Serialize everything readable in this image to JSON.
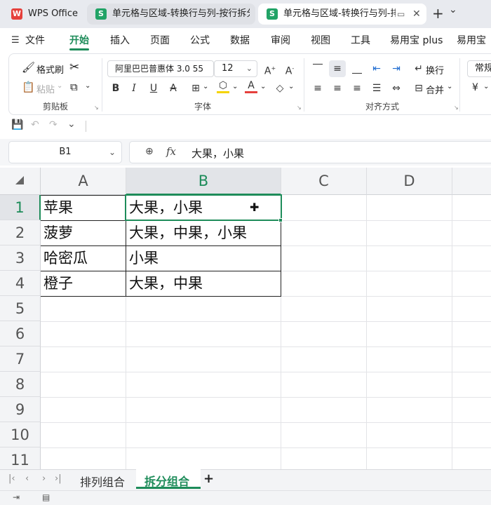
{
  "tabs": [
    {
      "logo": "W",
      "title": "WPS Office",
      "active": false
    },
    {
      "logo": "S",
      "title": "单元格与区域-转换行与列-按行拆分",
      "active": false
    },
    {
      "logo": "S",
      "title": "单元格与区域-转换行与列-排",
      "active": true
    }
  ],
  "tab_new_icon": "+",
  "tab_list_icon": "⌄",
  "menu": {
    "file": "文件",
    "items": [
      "开始",
      "插入",
      "页面",
      "公式",
      "数据",
      "审阅",
      "视图",
      "工具",
      "易用宝 plus",
      "易用宝"
    ],
    "active": "开始"
  },
  "ribbon": {
    "format_painter": "格式刷",
    "paste": "粘贴",
    "clipboard_group": "剪贴板",
    "font_name": "阿里巴巴普惠体 3.0 55",
    "font_size": "12",
    "font_group": "字体",
    "wrap": "换行",
    "merge": "合并",
    "align_group": "对齐方式",
    "number_format": "常规",
    "currency_icon": "¥"
  },
  "namebox": "B1",
  "formula": "大果，小果",
  "columns": [
    "A",
    "B",
    "C",
    "D"
  ],
  "rows": [
    "1",
    "2",
    "3",
    "4",
    "5",
    "6",
    "7",
    "8",
    "9",
    "10",
    "11"
  ],
  "cells": [
    {
      "a": "苹果",
      "b": "大果，小果"
    },
    {
      "a": "菠萝",
      "b": "大果，中果，小果"
    },
    {
      "a": "哈密瓜",
      "b": "小果"
    },
    {
      "a": "橙子",
      "b": "大果，中果"
    }
  ],
  "sheets": [
    {
      "name": "排列组合",
      "active": false
    },
    {
      "name": "拆分组合",
      "active": true
    }
  ],
  "add_sheet": "+",
  "colors": {
    "accent": "#1e8c5a",
    "wps_red": "#e5403c",
    "sheets_green": "#21a366"
  }
}
